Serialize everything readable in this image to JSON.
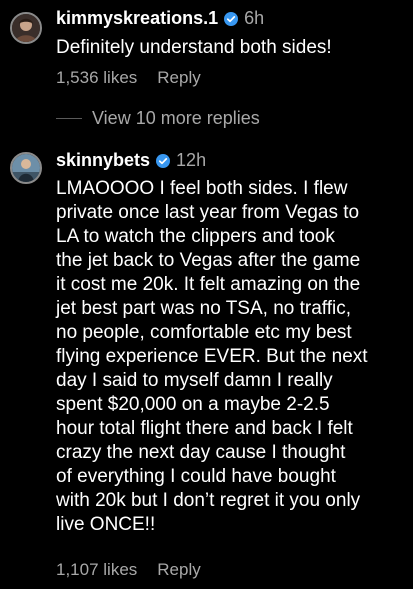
{
  "accent_color": "#3897f0",
  "comments": [
    {
      "username": "kimmyskreations.1",
      "verified": true,
      "time": "6h",
      "text": "Definitely understand both sides!",
      "likes": "1,536 likes",
      "reply_label": "Reply"
    },
    {
      "username": "skinnybets",
      "verified": true,
      "time": "12h",
      "text": "LMAOOOO I feel both sides. I flew\nprivate once last year from Vegas to\nLA to watch the clippers and took\nthe jet back to Vegas after the game\nit cost me 20k. It felt amazing on the\njet best part was no TSA, no traffic,\nno people, comfortable etc my best\nflying experience EVER. But the next\nday I said to myself damn I really\nspent $20,000 on a maybe 2-2.5\nhour total flight there and back I felt\ncrazy the next day cause I thought\nof everything I could have bought\nwith 20k but I don’t regret it you only\nlive ONCE!!",
      "likes": "1,107 likes",
      "reply_label": "Reply"
    }
  ],
  "view_more_label": "View 10 more replies"
}
